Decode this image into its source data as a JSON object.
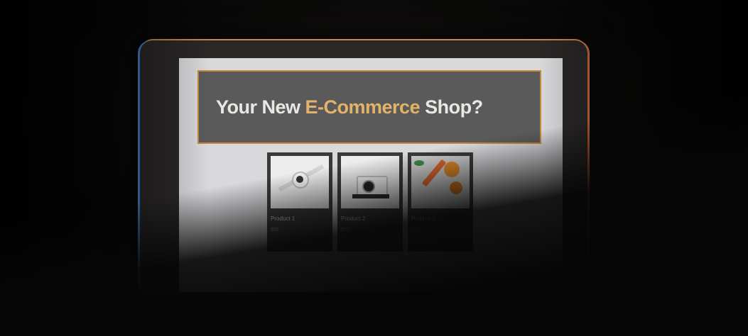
{
  "banner": {
    "title_prefix": "Your New ",
    "title_accent": "E-Commerce",
    "title_suffix": " Shop?"
  },
  "colors": {
    "accent": "#e4b36a",
    "banner_border": "#c8893e",
    "banner_bg": "#5b5a5a"
  },
  "products": [
    {
      "name": "Product 1",
      "price": "$99",
      "icon": "watch-icon"
    },
    {
      "name": "Product 2",
      "price": "$99",
      "icon": "camera-icon"
    },
    {
      "name": "Product 3",
      "price": "$99",
      "icon": "citrus-icon"
    }
  ]
}
